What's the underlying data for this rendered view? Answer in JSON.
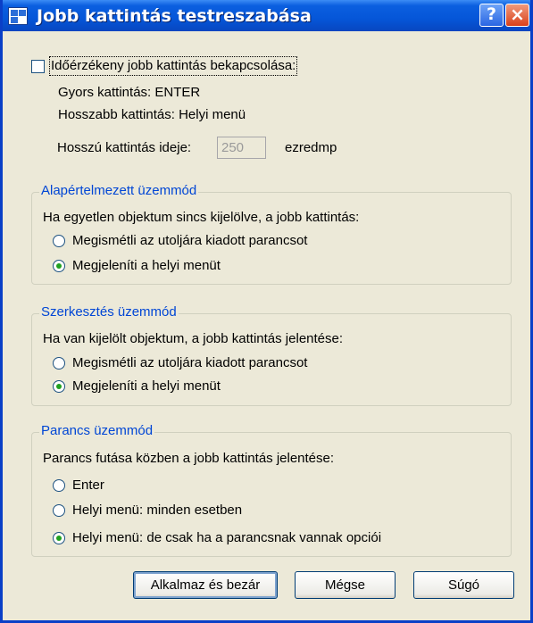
{
  "window": {
    "title": "Jobb kattintás testreszabása",
    "help_glyph": "?",
    "close_glyph": "×",
    "app_icon": "app-icon"
  },
  "timesensitive": {
    "checkbox_label": "Időérzékeny jobb kattintás bekapcsolása:",
    "quick_click": "Gyors kattintás: ENTER",
    "long_click": "Hosszabb kattintás: Helyi menü",
    "duration_label": "Hosszú kattintás ideje:",
    "duration_value": "250",
    "duration_unit": "ezredmp"
  },
  "default_mode": {
    "legend": "Alapértelmezett üzemmód",
    "prompt": "Ha egyetlen objektum sincs kijelölve, a jobb kattintás:",
    "options": [
      "Megismétli az utoljára kiadott parancsot",
      "Megjeleníti a helyi menüt"
    ],
    "selected": 1
  },
  "edit_mode": {
    "legend": "Szerkesztés üzemmód",
    "prompt": "Ha van kijelölt objektum, a jobb kattintás jelentése:",
    "options": [
      "Megismétli az utoljára kiadott parancsot",
      "Megjeleníti a helyi menüt"
    ],
    "selected": 1
  },
  "command_mode": {
    "legend": "Parancs üzemmód",
    "prompt": "Parancs futása közben a jobb kattintás jelentése:",
    "options": [
      "Enter",
      "Helyi menü: minden esetben",
      "Helyi menü: de csak ha a parancsnak vannak opciói"
    ],
    "selected": 2
  },
  "buttons": {
    "apply": "Alkalmaz és bezár",
    "cancel": "Mégse",
    "help": "Súgó"
  },
  "colors": {
    "titlebar": "#0556d8",
    "group_legend": "#0046d5",
    "radio_selected": "#21a121",
    "dialog_bg": "#ece9d8"
  }
}
